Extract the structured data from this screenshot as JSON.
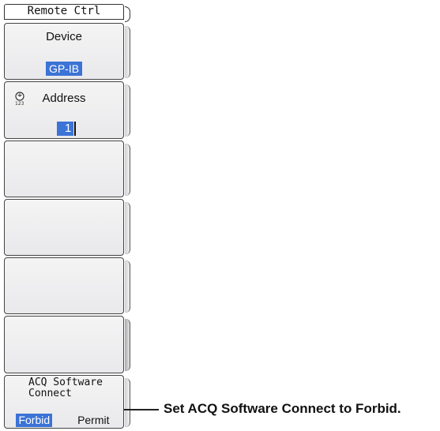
{
  "menu": {
    "title": "Remote Ctrl",
    "device": {
      "label": "Device",
      "value": "GP-IB"
    },
    "address": {
      "icon": "jog-dial-icon",
      "label": "Address",
      "value": "1"
    },
    "acq_software_connect": {
      "label_line1": "ACQ Software",
      "label_line2": "Connect",
      "options": [
        "Forbid",
        "Permit"
      ],
      "selected": "Forbid"
    }
  },
  "callout": {
    "text": "Set ACQ Software Connect to Forbid."
  },
  "colors": {
    "highlight": "#3b73d6",
    "panel": "#f0f0f2",
    "border": "#444444"
  }
}
